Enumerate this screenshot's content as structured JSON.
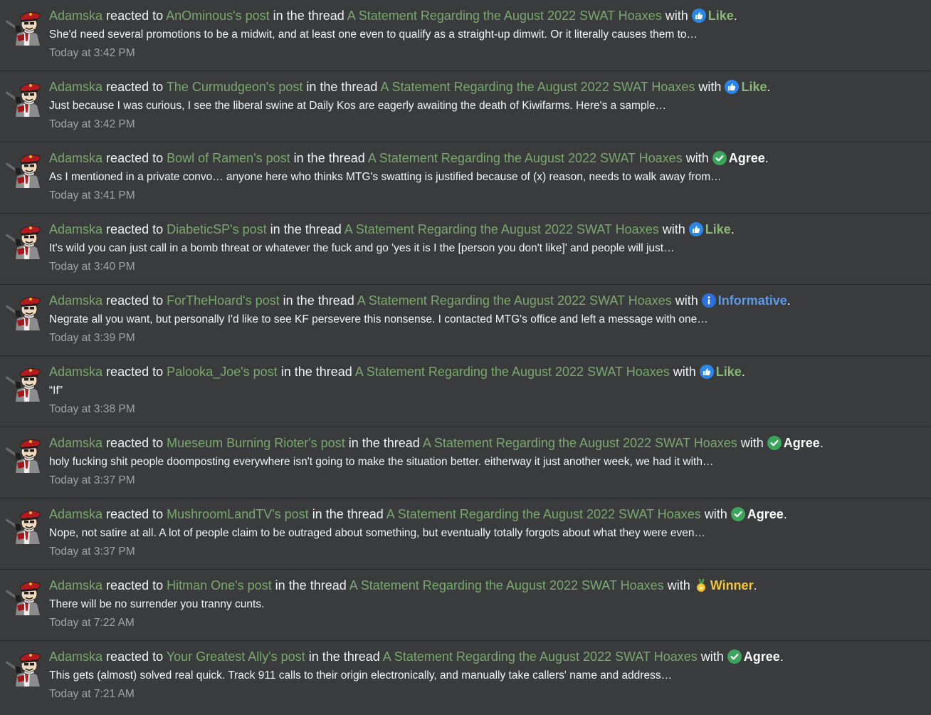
{
  "labels": {
    "reacted_to": "reacted to",
    "in_the_thread": "in the thread",
    "with": "with",
    "period": "."
  },
  "colors": {
    "background": "#3a3b3c",
    "link": "#7aa86e",
    "like": "#8ab87a",
    "agree": "#ffffff",
    "informative": "#5c9ae6",
    "winner": "#f2c541",
    "timestamp": "#a3a3a3"
  },
  "items": [
    {
      "user": "Adamska",
      "post": "AnOminous's post",
      "thread": "A Statement Regarding the August 2022 SWAT Hoaxes",
      "reaction": "Like",
      "reaction_type": "like",
      "reaction_icon": "thumbs-up-icon",
      "snippet": "She'd need several promotions to be a midwit, and at least one even to qualify as a straight-up dimwit. Or it literally causes them to…",
      "time": "Today at 3:42 PM"
    },
    {
      "user": "Adamska",
      "post": "The Curmudgeon's post",
      "thread": "A Statement Regarding the August 2022 SWAT Hoaxes",
      "reaction": "Like",
      "reaction_type": "like",
      "reaction_icon": "thumbs-up-icon",
      "snippet": "Just because I was curious, I see the liberal swine at Daily Kos are eagerly awaiting the death of Kiwifarms. Here's a sample…",
      "time": "Today at 3:42 PM"
    },
    {
      "user": "Adamska",
      "post": "Bowl of Ramen's post",
      "thread": "A Statement Regarding the August 2022 SWAT Hoaxes",
      "reaction": "Agree",
      "reaction_type": "agree",
      "reaction_icon": "checkmark-icon",
      "snippet": "As I mentioned in a private convo… anyone here who thinks MTG's swatting is justified because of (x) reason, needs to walk away from…",
      "time": "Today at 3:41 PM"
    },
    {
      "user": "Adamska",
      "post": "DiabeticSP's post",
      "thread": "A Statement Regarding the August 2022 SWAT Hoaxes",
      "reaction": "Like",
      "reaction_type": "like",
      "reaction_icon": "thumbs-up-icon",
      "snippet": "It's wild you can just call in a bomb threat or whatever the fuck and go 'yes it is I the [person you don't like]' and people will just…",
      "time": "Today at 3:40 PM"
    },
    {
      "user": "Adamska",
      "post": "ForTheHoard's post",
      "thread": "A Statement Regarding the August 2022 SWAT Hoaxes",
      "reaction": "Informative",
      "reaction_type": "informative",
      "reaction_icon": "info-icon",
      "snippet": "Negrate all you want, but personally I'd like to see KF persevere this nonsense. I contacted MTG's office and left a message with one…",
      "time": "Today at 3:39 PM"
    },
    {
      "user": "Adamska",
      "post": "Palooka_Joe's post",
      "thread": "A Statement Regarding the August 2022 SWAT Hoaxes",
      "reaction": "Like",
      "reaction_type": "like",
      "reaction_icon": "thumbs-up-icon",
      "snippet": "“If”",
      "time": "Today at 3:38 PM"
    },
    {
      "user": "Adamska",
      "post": "Mueseum Burning Rioter's post",
      "thread": "A Statement Regarding the August 2022 SWAT Hoaxes",
      "reaction": "Agree",
      "reaction_type": "agree",
      "reaction_icon": "checkmark-icon",
      "snippet": "holy fucking shit people doomposting everywhere isn't going to make the situation better. eitherway it just another week, we had it with…",
      "time": "Today at 3:37 PM"
    },
    {
      "user": "Adamska",
      "post": "MushroomLandTV's post",
      "thread": "A Statement Regarding the August 2022 SWAT Hoaxes",
      "reaction": "Agree",
      "reaction_type": "agree",
      "reaction_icon": "checkmark-icon",
      "snippet": "Nope, not satire at all. A lot of people claim to be outraged about something, but eventually totally forgots about what they were even…",
      "time": "Today at 3:37 PM"
    },
    {
      "user": "Adamska",
      "post": "Hitman One's post",
      "thread": "A Statement Regarding the August 2022 SWAT Hoaxes",
      "reaction": "Winner",
      "reaction_type": "winner",
      "reaction_icon": "medal-icon",
      "snippet": "There will be no surrender you tranny cunts.",
      "time": "Today at 7:22 AM"
    },
    {
      "user": "Adamska",
      "post": "Your Greatest Ally's post",
      "thread": "A Statement Regarding the August 2022 SWAT Hoaxes",
      "reaction": "Agree",
      "reaction_type": "agree",
      "reaction_icon": "checkmark-icon",
      "snippet": "This gets (almost) solved real quick. Track 911 calls to their origin electronically, and manually take callers' name and address…",
      "time": "Today at 7:21 AM"
    }
  ]
}
